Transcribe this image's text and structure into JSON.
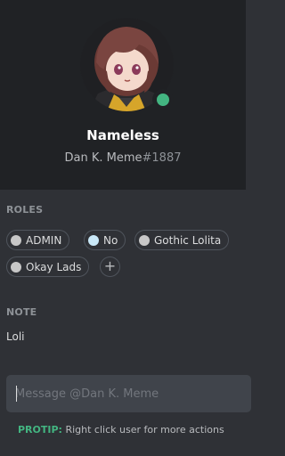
{
  "profile": {
    "username": "Nameless",
    "tag_name": "Dan K. Meme",
    "discriminator": "#1887",
    "status": "online",
    "status_color": "#43b581",
    "avatar_icon": "anime-avatar"
  },
  "roles": {
    "title": "ROLES",
    "items": [
      {
        "label": "ADMIN",
        "color": "#c7c7c7"
      },
      {
        "label": "No",
        "color": "#c9e8f8"
      },
      {
        "label": "Gothic Lolita",
        "color": "#c7c7c7"
      },
      {
        "label": "Okay Lads",
        "color": "#c7c7c7"
      }
    ],
    "add_icon": "plus-icon",
    "add_symbol": "+"
  },
  "note": {
    "title": "NOTE",
    "text": "Loli"
  },
  "message": {
    "placeholder": "Message @Dan K. Meme"
  },
  "protip": {
    "label": "PROTIP:",
    "text": " Right click user for more actions",
    "label_color": "#43b581"
  }
}
